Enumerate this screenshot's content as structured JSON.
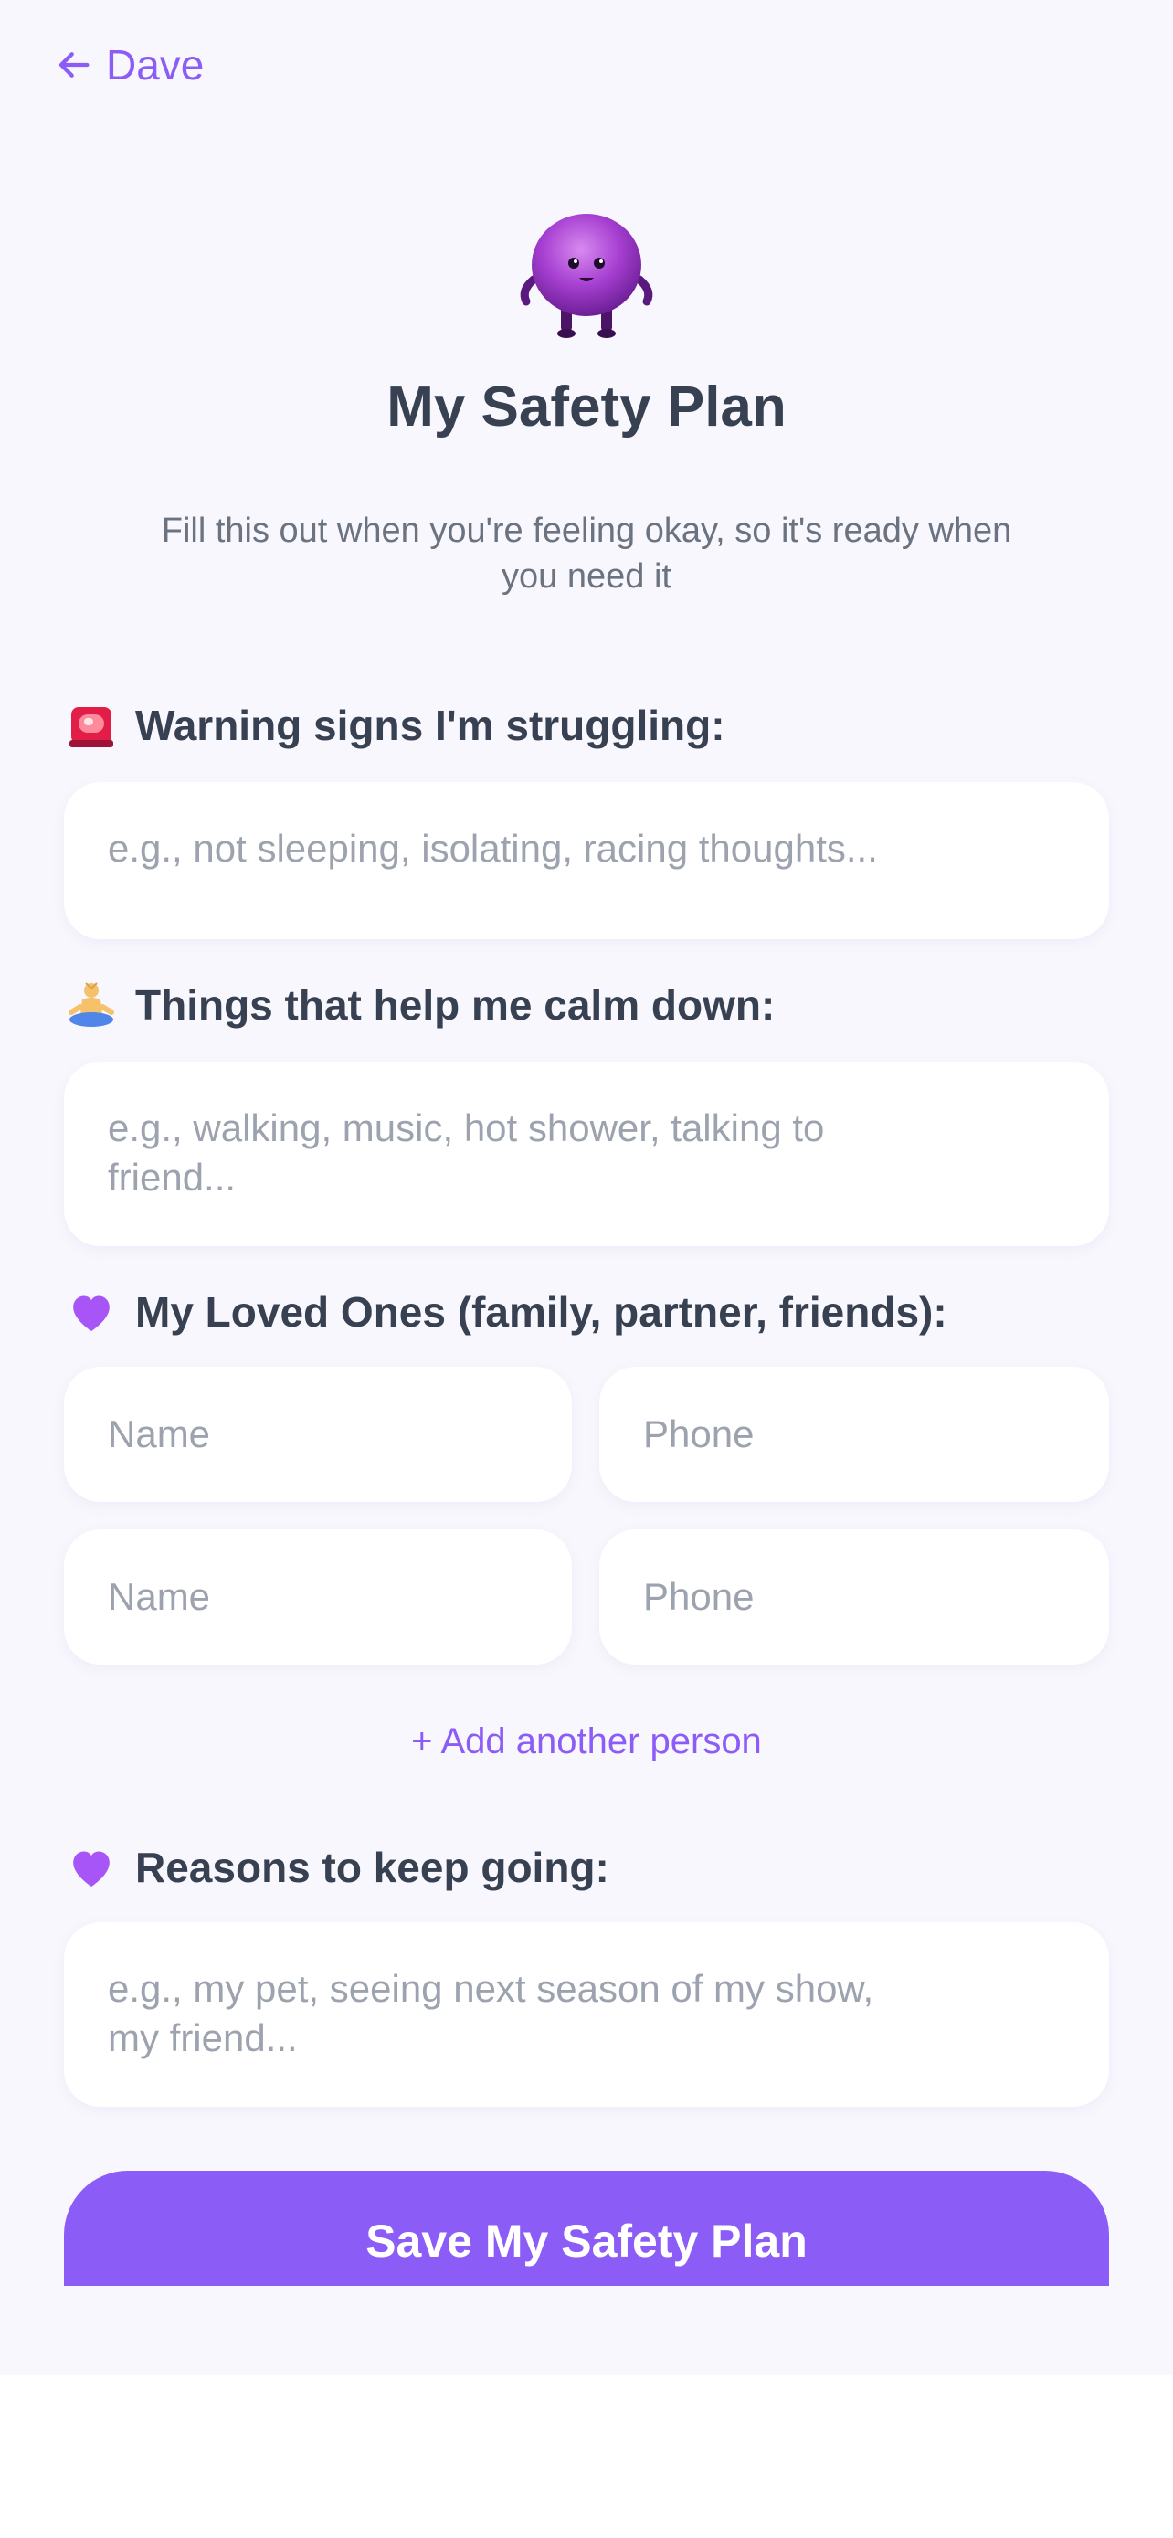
{
  "nav": {
    "back_label": "Dave"
  },
  "header": {
    "title": "My Safety Plan",
    "subtitle": "Fill this out when you're feeling okay, so it's ready when you need it"
  },
  "sections": {
    "warning": {
      "label": "Warning signs I'm struggling:",
      "icon": "siren-icon",
      "placeholder": "e.g., not sleeping, isolating, racing thoughts..."
    },
    "calm": {
      "label": "Things that help me calm down:",
      "icon": "meditation-icon",
      "placeholder": "e.g., walking, music, hot shower, talking to friend..."
    },
    "loved": {
      "label": "My Loved Ones (family, partner, friends):",
      "icon": "purple-heart-icon",
      "name_placeholder": "Name",
      "phone_placeholder": "Phone",
      "add_label": "+ Add another person"
    },
    "reasons": {
      "label": "Reasons to keep going:",
      "icon": "purple-heart-icon",
      "placeholder": "e.g., my pet, seeing next season of my show, my friend..."
    }
  },
  "actions": {
    "save_label": "Save My Safety Plan"
  },
  "colors": {
    "accent": "#8b5cf6",
    "background": "#f8f7fd",
    "text": "#374151",
    "placeholder": "#9ca3af"
  }
}
